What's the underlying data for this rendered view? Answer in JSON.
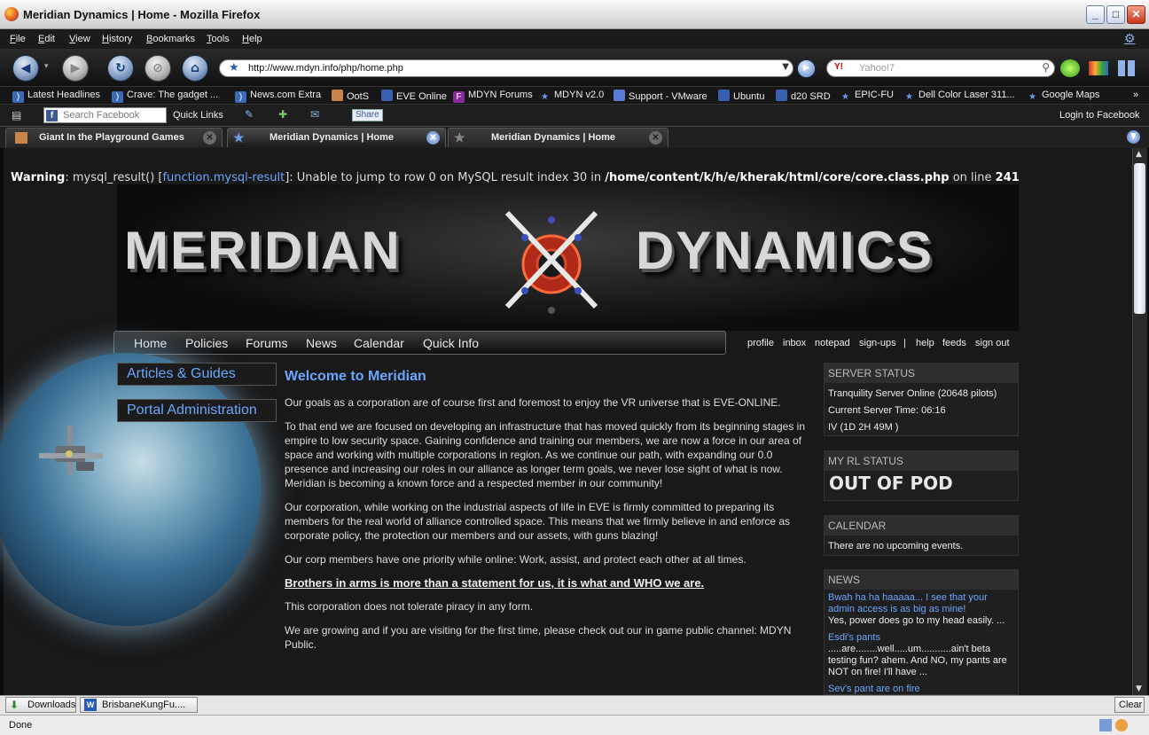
{
  "window": {
    "title": "Meridian Dynamics | Home - Mozilla Firefox",
    "minimize": "_",
    "maximize": "□",
    "close": "✕"
  },
  "menu": [
    "File",
    "Edit",
    "View",
    "History",
    "Bookmarks",
    "Tools",
    "Help"
  ],
  "nav": {
    "url": "http://www.mdyn.info/php/home.php",
    "search_placeholder": "Yahoo!7",
    "search_engine": "Y!"
  },
  "bookmarks": [
    {
      "label": "Latest Headlines",
      "icon": "rss-icon"
    },
    {
      "label": "Crave: The gadget ...",
      "icon": "rss-icon"
    },
    {
      "label": "News.com Extra",
      "icon": "rss-icon"
    },
    {
      "label": "OotS",
      "icon": "comic-icon"
    },
    {
      "label": "EVE Online",
      "icon": "folder-icon"
    },
    {
      "label": "MDYN Forums",
      "icon": "forum-icon"
    },
    {
      "label": "MDYN v2.0",
      "icon": "star-icon"
    },
    {
      "label": "Support - VMware",
      "icon": "page-icon"
    },
    {
      "label": "Ubuntu",
      "icon": "folder-icon"
    },
    {
      "label": "d20 SRD",
      "icon": "folder-icon"
    },
    {
      "label": "EPIC-FU",
      "icon": "star-icon"
    },
    {
      "label": "Dell Color Laser 311...",
      "icon": "star-icon"
    },
    {
      "label": "Google Maps",
      "icon": "star-icon"
    }
  ],
  "facebook": {
    "search_placeholder": "Search Facebook",
    "quick_links": "Quick Links",
    "share": "Share",
    "login": "Login to Facebook"
  },
  "tabs": [
    {
      "label": "Giant In the Playground Games"
    },
    {
      "label": "Meridian Dynamics | Home"
    },
    {
      "label": "Meridian Dynamics | Home"
    }
  ],
  "page": {
    "warning": {
      "prefix": "Warning",
      "func": "mysql_result() [",
      "link": "function.mysql-result",
      "mid": "]: Unable to jump to row 0 on MySQL result index 30 in ",
      "path": "/home/content/k/h/e/kherak/html/core/core.class.php",
      "online": " on line ",
      "line": "241"
    },
    "banner": {
      "left": "MERIDIAN",
      "right": "DYNAMICS"
    },
    "navlinks": [
      "Home",
      "Policies",
      "Forums",
      "News",
      "Calendar",
      "Quick Info"
    ],
    "toplinks": [
      "profile",
      "inbox",
      "notepad",
      "sign-ups",
      "|",
      "help",
      "feeds",
      "sign out"
    ],
    "sidebox": [
      "Articles & Guides",
      "Portal Administration"
    ],
    "welcome": "Welcome to Meridian",
    "paragraphs": [
      "Our goals as a corporation are of course first and foremost to enjoy the VR universe that is EVE-ONLINE.",
      "To that end we are focused on developing an infrastructure that has moved quickly from its beginning stages in empire to low security space. Gaining confidence and training our members, we are now a force in our area of space and working with multiple corporations in region. As we continue our path, with expanding our 0.0 presence and increasing our roles in our alliance as longer term goals, we never lose sight of what is now. Meridian is becoming a known force and a respected member in our community!",
      "Our corporation, while working on the industrial aspects of life in EVE is firmly committed to preparing its members for the real world of alliance controlled space. This means that we firmly believe in and enforce as corporate policy, the protection our members and our assets, with guns blazing!",
      "Our corp members have one priority while online: Work, assist, and protect each other at all times."
    ],
    "brothers": "Brothers in arms is more than a statement for us, it is what and WHO we are.",
    "piracy": "This corporation does not tolerate piracy in any form.",
    "growing": "We are growing and if you are visiting for the first time, please check out our in game public channel: MDYN Public."
  },
  "right": {
    "server": {
      "title": "SERVER STATUS",
      "l1": "Tranquility Server Online (20648 pilots)",
      "l2": "Current Server Time: 06:16",
      "l3": "IV (1D 2H 49M )"
    },
    "rl": {
      "title": "MY RL STATUS",
      "value": "OUT OF POD"
    },
    "calendar": {
      "title": "CALENDAR",
      "text": "There are no upcoming events."
    },
    "news": {
      "title": "NEWS",
      "items": [
        {
          "link": "Bwah ha ha haaaaa... I see that your admin access is as big as mine!",
          "text": "Yes, power does go to my head easily. ..."
        },
        {
          "link": "Esdi's pants",
          "text": ".....are........well.....um...........ain't beta testing fun? ahem. And NO, my pants are NOT on fire! I'll have ..."
        },
        {
          "link": "Sev's pant are on fire",
          "text": ""
        }
      ]
    }
  },
  "downloads": {
    "downloads": "Downloads",
    "file": "BrisbaneKungFu....",
    "clear": "Clear"
  },
  "status": "Done"
}
